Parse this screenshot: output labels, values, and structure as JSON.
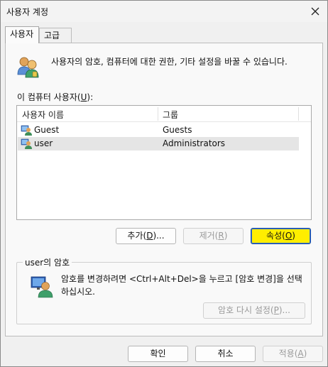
{
  "window": {
    "title": "사용자 계정",
    "close_glyph": "✕"
  },
  "tabs": [
    {
      "label": "사용자",
      "active": true
    },
    {
      "label": "고급",
      "active": false
    }
  ],
  "description": "사용자의 암호, 컴퓨터에 대한 권한, 기타 설정을 바꿀 수 있습니다.",
  "user_list": {
    "label_prefix": "이 컴퓨터 사용자(",
    "label_key": "U",
    "label_suffix": "):",
    "columns": [
      "사용자 이름",
      "그룹"
    ],
    "rows": [
      {
        "name": "Guest",
        "group": "Guests",
        "selected": false
      },
      {
        "name": "user",
        "group": "Administrators",
        "selected": true
      }
    ]
  },
  "list_buttons": {
    "add": {
      "prefix": "추가(",
      "key": "D",
      "suffix": ")..."
    },
    "remove": {
      "prefix": "제거(",
      "key": "R",
      "suffix": ")"
    },
    "properties": {
      "prefix": "속성(",
      "key": "O",
      "suffix": ")"
    }
  },
  "password_group": {
    "title": "user의 암호",
    "text": "암호를 변경하려면 <Ctrl+Alt+Del>을 누르고 [암호 변경]을 선택하십시오.",
    "reset_button": {
      "prefix": "암호 다시 설정(",
      "key": "P",
      "suffix": ")..."
    }
  },
  "footer": {
    "ok": "확인",
    "cancel": "취소",
    "apply": {
      "prefix": "적용(",
      "key": "A",
      "suffix": ")"
    }
  },
  "colors": {
    "highlight": "#ffee00",
    "selected_row": "#e5e5e5",
    "window_bg": "#f0f0f0"
  },
  "icons": [
    "users-icon",
    "user-icon",
    "user-admin-icon",
    "close-icon"
  ]
}
